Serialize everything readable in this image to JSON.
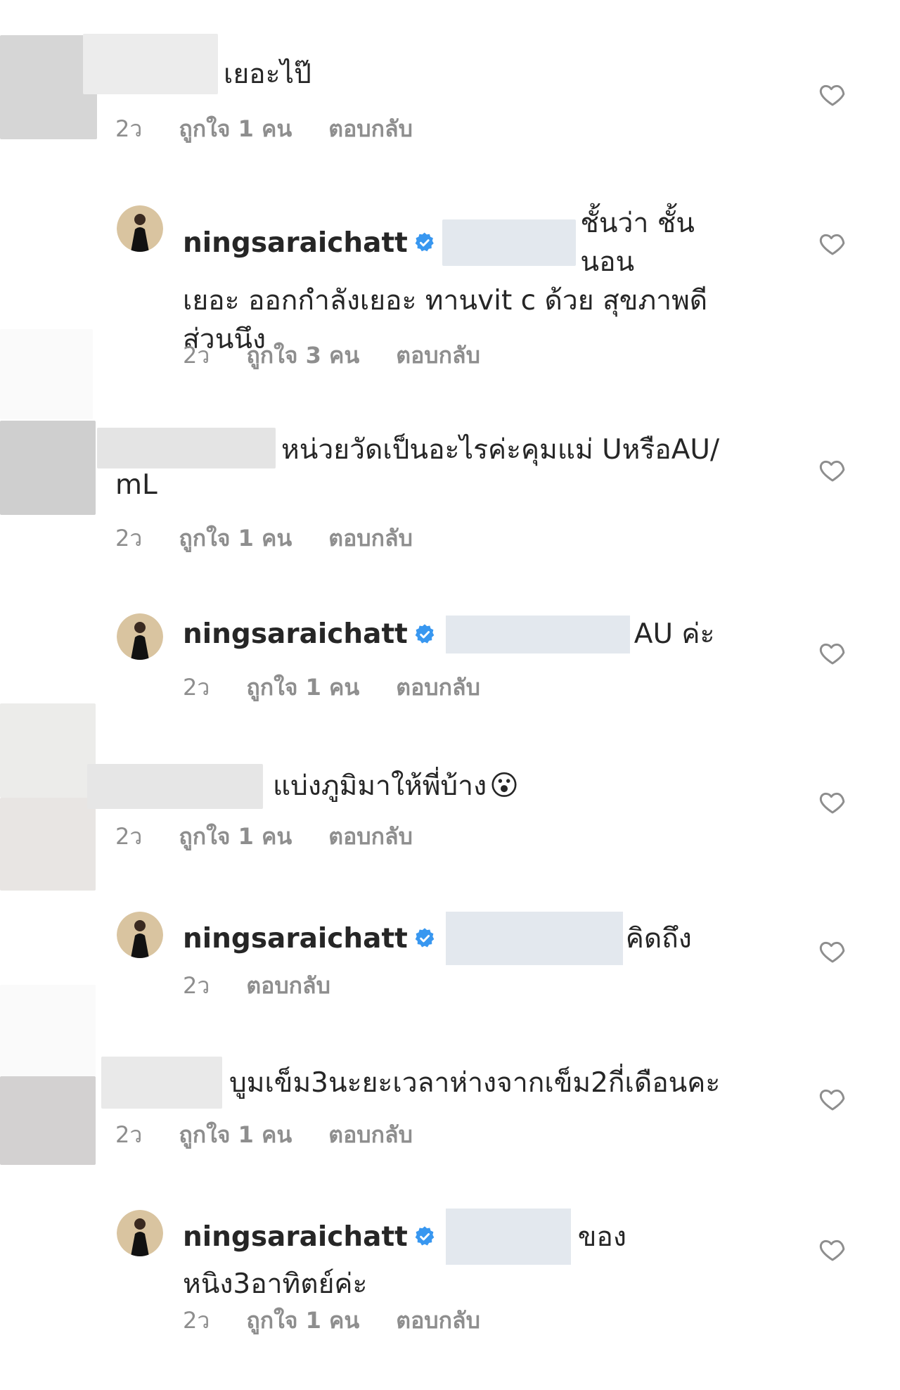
{
  "comments": [
    {
      "text": "เยอะไป๊",
      "time": "2ว",
      "likes": "ถูกใจ 1 คน",
      "reply": "ตอบกลับ"
    },
    {
      "username": "ningsaraichatt",
      "text_line1": "ชั้นว่า ชั้นนอน",
      "text_line2": "เยอะ ออกกำลังเยอะ ทานvit c ด้วย สุขภาพดี",
      "text_line3": "ส่วนนึง",
      "time": "2ว",
      "likes": "ถูกใจ 3 คน",
      "reply": "ตอบกลับ"
    },
    {
      "text_line1": "หน่วยวัดเป็นอะไรค่ะคุมแม่ UหรือAU/",
      "text_line2": "mL",
      "time": "2ว",
      "likes": "ถูกใจ 1 คน",
      "reply": "ตอบกลับ"
    },
    {
      "username": "ningsaraichatt",
      "text": "AU ค่ะ",
      "time": "2ว",
      "likes": "ถูกใจ 1 คน",
      "reply": "ตอบกลับ"
    },
    {
      "text": "แบ่งภูมิมาให้พี่บ้าง",
      "emoji": "😮",
      "time": "2ว",
      "likes": "ถูกใจ 1 คน",
      "reply": "ตอบกลับ"
    },
    {
      "username": "ningsaraichatt",
      "text": "คิดถึง",
      "time": "2ว",
      "reply": "ตอบกลับ"
    },
    {
      "text": "บูมเข็ม3นะยะเวลาห่างจากเข็ม2กี่เดือนคะ",
      "time": "2ว",
      "likes": "ถูกใจ 1 คน",
      "reply": "ตอบกลับ"
    },
    {
      "username": "ningsaraichatt",
      "text_line1": "ของ",
      "text_line2": "หนิง3อาทิตย์ค่ะ",
      "time": "2ว",
      "likes": "ถูกใจ 1 คน",
      "reply": "ตอบกลับ"
    }
  ],
  "icons": {
    "like": "heart-outline-icon",
    "verified": "verified-badge-icon"
  },
  "colors": {
    "meta": "#8e8e8e",
    "verified": "#3897f0",
    "blur_light": "#ebebeb",
    "blur_mid": "#d9d9d9",
    "blur_blue": "#e3e8ee"
  }
}
